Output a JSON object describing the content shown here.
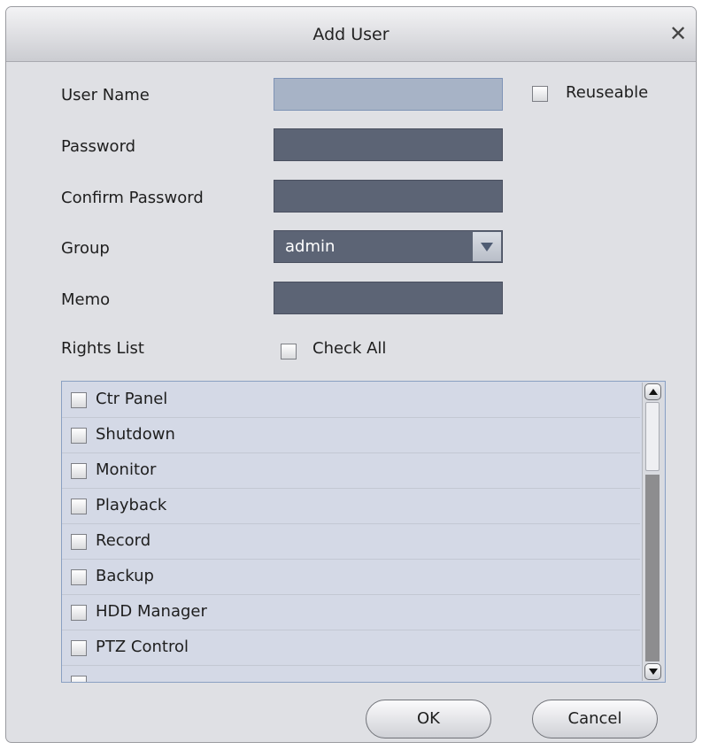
{
  "dialog": {
    "title": "Add User",
    "close_glyph": "✕"
  },
  "form": {
    "user_name_label": "User Name",
    "user_name_value": "",
    "reuseable_label": "Reuseable",
    "reuseable_checked": false,
    "password_label": "Password",
    "password_value": "",
    "confirm_password_label": "Confirm Password",
    "confirm_password_value": "",
    "group_label": "Group",
    "group_value": "admin",
    "memo_label": "Memo",
    "memo_value": ""
  },
  "rights": {
    "label": "Rights List",
    "check_all_label": "Check All",
    "check_all_checked": false,
    "items": [
      {
        "label": "Ctr Panel",
        "checked": false
      },
      {
        "label": "Shutdown",
        "checked": false
      },
      {
        "label": "Monitor",
        "checked": false
      },
      {
        "label": "Playback",
        "checked": false
      },
      {
        "label": "Record",
        "checked": false
      },
      {
        "label": "Backup",
        "checked": false
      },
      {
        "label": "HDD Manager",
        "checked": false
      },
      {
        "label": "PTZ Control",
        "checked": false
      },
      {
        "label": "",
        "checked": false
      }
    ]
  },
  "buttons": {
    "ok_label": "OK",
    "cancel_label": "Cancel"
  },
  "colors": {
    "dialog_bg": "#dfe0e4",
    "field_bg": "#5c6475",
    "active_field_bg": "#a7b3c6",
    "list_bg": "#d4d9e6",
    "list_border": "#8aa0c2"
  },
  "icons": {
    "close": "close-icon",
    "dropdown": "chevron-down-icon",
    "scroll_up": "scroll-up-arrow-icon",
    "scroll_down": "scroll-down-arrow-icon"
  }
}
